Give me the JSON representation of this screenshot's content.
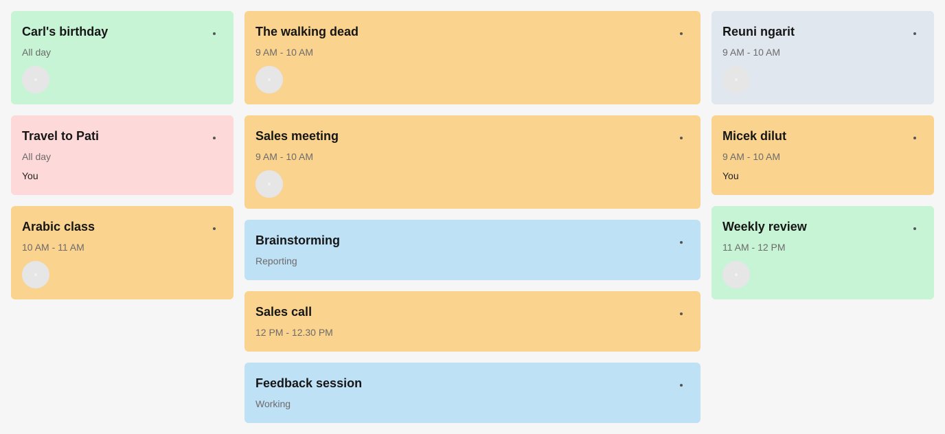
{
  "colors": {
    "background": "#f6f6f6",
    "green": "#c6f4d5",
    "red": "#fdd9d9",
    "orange": "#fad38f",
    "blue": "#bfe1f6",
    "gray": "#e1e7ef"
  },
  "icons": {
    "menu": "more-dot-icon",
    "avatar": "avatar-placeholder-icon"
  },
  "columns": [
    {
      "cards": [
        {
          "title": "Carl's birthday",
          "subtitle": "All day"
        },
        {
          "title": "Travel to Pati",
          "subtitle": "All day",
          "owner": "You"
        },
        {
          "title": "Arabic class",
          "subtitle": "10 AM - 11 AM"
        }
      ]
    },
    {
      "cards": [
        {
          "title": "The walking dead",
          "subtitle": "9 AM - 10 AM"
        },
        {
          "title": "Sales meeting",
          "subtitle": "9 AM - 10 AM"
        },
        {
          "title": "Brainstorming",
          "subtitle": "Reporting"
        },
        {
          "title": "Sales call",
          "subtitle": "12 PM - 12.30 PM"
        },
        {
          "title": "Feedback session",
          "subtitle": "Working"
        }
      ]
    },
    {
      "cards": [
        {
          "title": "Reuni ngarit",
          "subtitle": "9 AM - 10 AM"
        },
        {
          "title": "Micek dilut",
          "subtitle": "9 AM - 10 AM",
          "owner": "You"
        },
        {
          "title": "Weekly review",
          "subtitle": "11 AM - 12 PM"
        }
      ]
    }
  ]
}
